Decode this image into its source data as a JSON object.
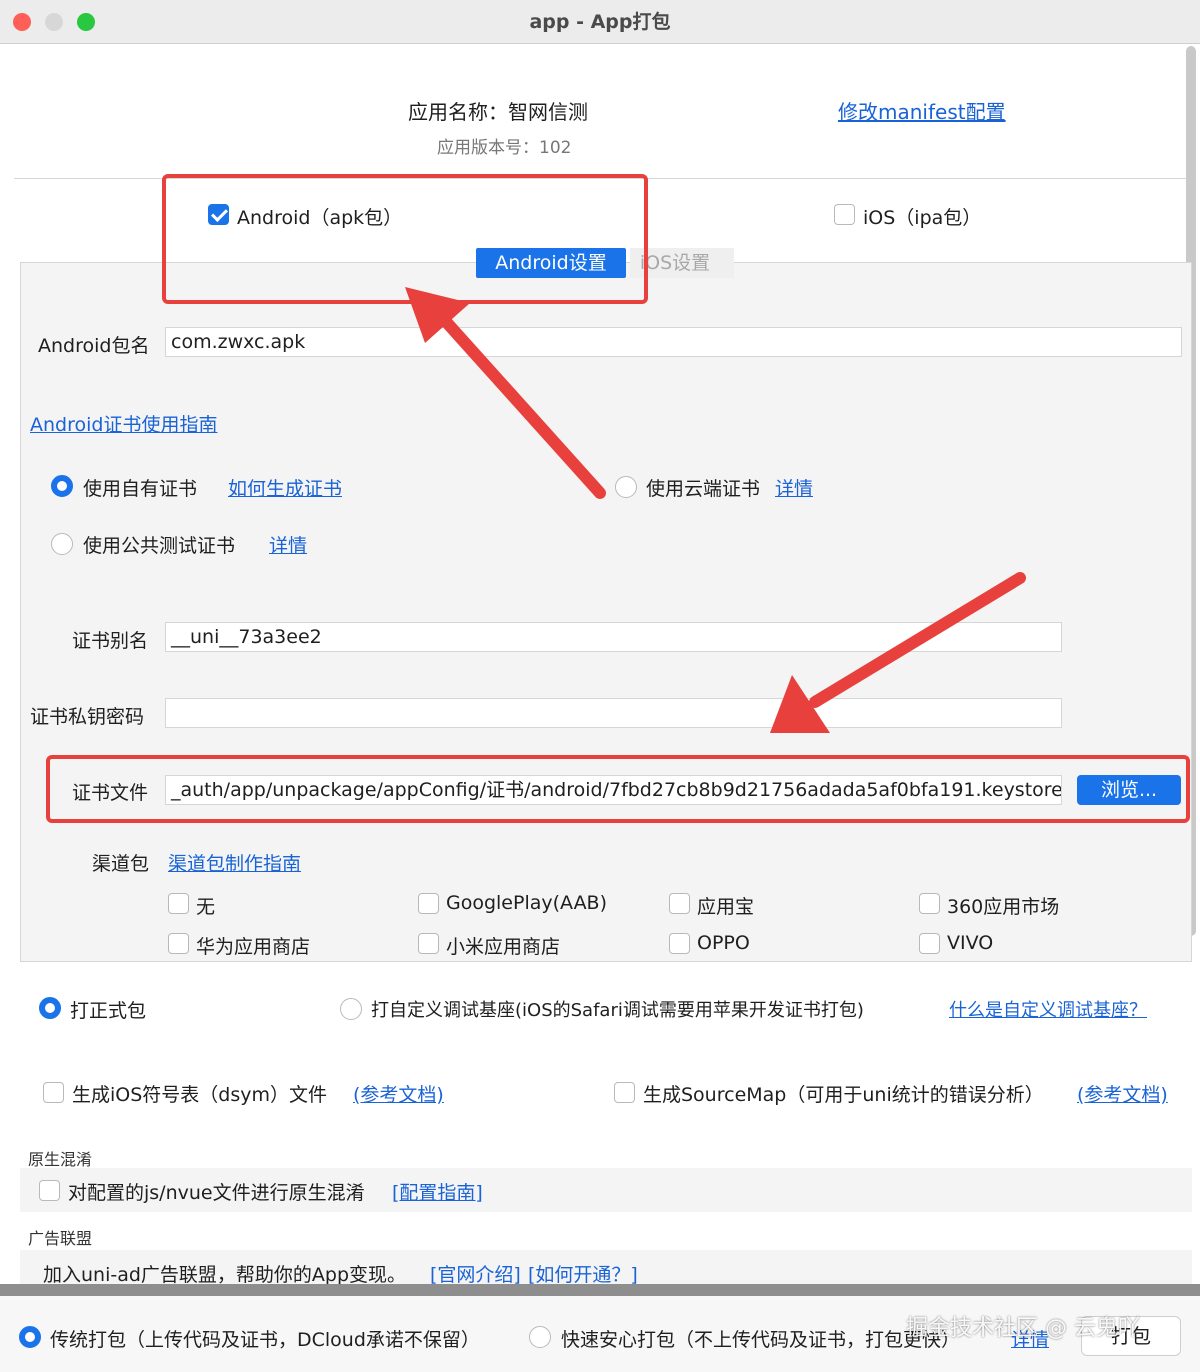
{
  "window": {
    "title": "app - App打包"
  },
  "header": {
    "app_name": "应用名称：智网信测",
    "app_version": "应用版本号：102",
    "manifest_link": "修改manifest配置"
  },
  "platforms": {
    "android_label": "Android（apk包）",
    "ios_label": "iOS（ipa包）",
    "android_tab": "Android设置",
    "ios_tab": "iOS设置"
  },
  "android": {
    "package_label": "Android包名",
    "package_value": "com.zwxc.apk",
    "cert_guide_link": "Android证书使用指南",
    "own_cert": "使用自有证书",
    "how_generate_link": "如何生成证书",
    "cloud_cert": "使用云端证书",
    "cloud_details_link": "详情",
    "public_cert": "使用公共测试证书",
    "public_details_link": "详情",
    "alias_label": "证书别名",
    "alias_value": "__uni__73a3ee2",
    "password_label": "证书私钥密码",
    "password_value": "",
    "file_label": "证书文件",
    "file_value": "_auth/app/unpackage/appConfig/证书/android/7fbd27cb8b9d21756adada5af0bfa191.keystore",
    "browse_button": "浏览...",
    "channel_label": "渠道包",
    "channel_guide_link": "渠道包制作指南",
    "channels": [
      "无",
      "GooglePlay(AAB)",
      "应用宝",
      "360应用市场",
      "华为应用商店",
      "小米应用商店",
      "OPPO",
      "VIVO"
    ]
  },
  "build_type": {
    "release": "打正式包",
    "custom_debug": "打自定义调试基座(iOS的Safari调试需要用苹果开发证书打包)",
    "custom_debug_link": "什么是自定义调试基座？"
  },
  "options": {
    "dsym": "生成iOS符号表（dsym）文件",
    "dsym_link": "(参考文档)",
    "sourcemap": "生成SourceMap（可用于uni统计的错误分析）",
    "sourcemap_link": "(参考文档)"
  },
  "obfuscation": {
    "title": "原生混淆",
    "checkbox": "对配置的js/nvue文件进行原生混淆",
    "link": "[配置指南]"
  },
  "ad": {
    "title": "广告联盟",
    "text": "加入uni-ad广告联盟，帮助你的App变现。",
    "link1": "[官网介绍]",
    "link2": "[如何开通？]"
  },
  "footer": {
    "traditional": "传统打包（上传代码及证书，DCloud承诺不保留）",
    "fast": "快速安心打包（不上传代码及证书，打包更快）",
    "details_link": "详情",
    "pack_button": "打包",
    "watermark": "掘金技术社区 @ 云鬼吖"
  },
  "colors": {
    "accent": "#1a73e8",
    "annotation": "#e8413d"
  }
}
